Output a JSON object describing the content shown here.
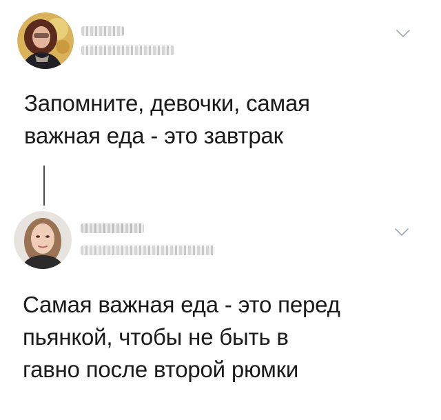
{
  "thread": {
    "tweets": [
      {
        "text": "Запомните, девочки, самая\nважная еда - это завтрак",
        "avatar_icon": "avatar-woman-curly-hair-icon",
        "menu_icon": "chevron-down-icon"
      },
      {
        "text": "Самая важная еда - это перед\nпьянкой, чтобы не быть в\nгавно после второй рюмки",
        "avatar_icon": "avatar-woman-long-hair-icon",
        "menu_icon": "chevron-down-icon"
      }
    ]
  },
  "colors": {
    "text": "#1a1a1a",
    "chevron": "#9aa8b5",
    "thread_line": "#4a4a4a",
    "background": "#ffffff"
  }
}
